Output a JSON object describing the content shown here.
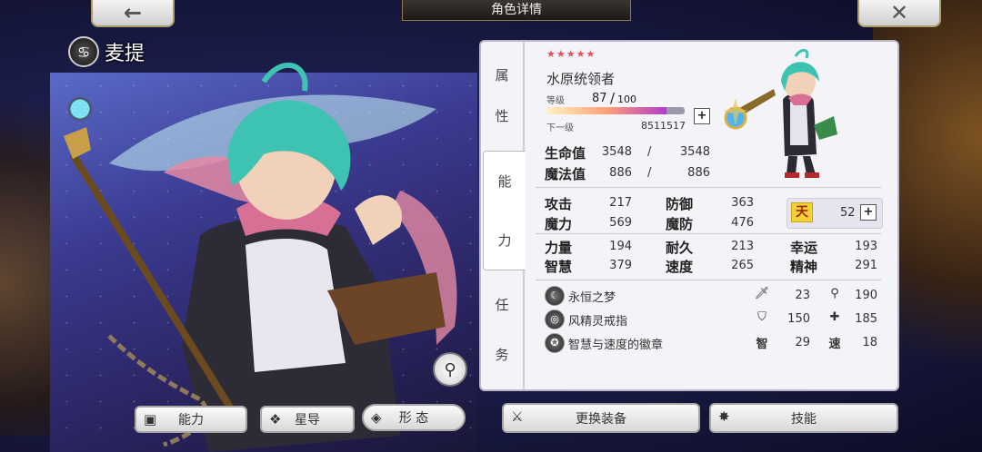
{
  "header": {
    "title": "角色详情",
    "back_icon": "←",
    "close_icon": "✕"
  },
  "character": {
    "name": "麦提",
    "element_icon": "♋"
  },
  "bottom_buttons": {
    "ability": "能力",
    "star_guide": "星导",
    "form": "形 态",
    "change_equip": "更换装备",
    "skill": "技能"
  },
  "tabs": {
    "attribute": [
      "属",
      "性"
    ],
    "ability": [
      "能",
      "力"
    ],
    "task": [
      "任",
      "务"
    ]
  },
  "profile": {
    "stars": "★★★★★",
    "class_name": "水原统领者",
    "level_label": "等级",
    "level_current": "87",
    "level_sep": "/",
    "level_max": "100",
    "level_progress": 0.87,
    "next_label": "下一级",
    "next_value": "8511517"
  },
  "vitals": {
    "hp_label": "生命值",
    "hp_current": "3548",
    "hp_max": "3548",
    "mp_label": "魔法值",
    "mp_current": "886",
    "mp_max": "886",
    "sep": "/"
  },
  "stats": {
    "atk_label": "攻击",
    "atk": "217",
    "def_label": "防御",
    "def": "363",
    "mag_label": "魔力",
    "mag": "569",
    "mdef_label": "魔防",
    "mdef": "476",
    "str_label": "力量",
    "str": "194",
    "dur_label": "耐久",
    "dur": "213",
    "luck_label": "幸运",
    "luck": "193",
    "int_label": "智慧",
    "int": "379",
    "spd_label": "速度",
    "spd": "265",
    "spirit_label": "精神",
    "spirit": "291",
    "bonus_icon": "天",
    "bonus_points": "52"
  },
  "equipment": [
    {
      "name": "永恒之梦",
      "icon": "☾",
      "s1_icon": "🗡",
      "s1": "23",
      "s2_icon": "⚲",
      "s2": "190"
    },
    {
      "name": "风精灵戒指",
      "icon": "◎",
      "s1_icon": "⛉",
      "s1": "150",
      "s2_icon": "✚",
      "s2": "185"
    },
    {
      "name": "智慧与速度的徽章",
      "icon": "✪",
      "s1_icon": "智",
      "s1": "29",
      "s2_icon": "速",
      "s2": "18"
    }
  ]
}
